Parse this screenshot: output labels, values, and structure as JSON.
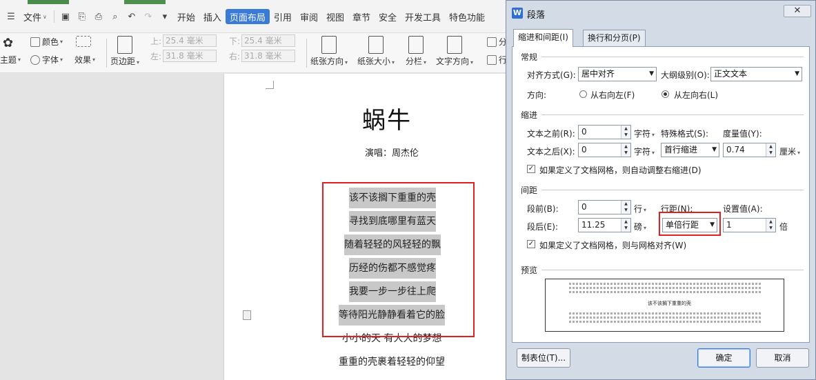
{
  "menubar": {
    "file_label": "文件",
    "tabs": [
      "开始",
      "插入",
      "页面布局",
      "引用",
      "审阅",
      "视图",
      "章节",
      "安全",
      "开发工具",
      "特色功能"
    ],
    "active_tab": "页面布局"
  },
  "ribbon": {
    "theme": "主题",
    "colors": "颜色",
    "fonts": "字体",
    "effects": "效果",
    "margins": "页边距",
    "top_label": "上:",
    "top_value": "25.4 毫米",
    "bottom_label": "下:",
    "bottom_value": "25.4 毫米",
    "left_label": "左:",
    "left_value": "31.8 毫米",
    "right_label": "右:",
    "right_value": "31.8 毫米",
    "orientation": "纸张方向",
    "size": "纸张大小",
    "columns": "分栏",
    "text_direction": "文字方向",
    "partial_1": "分",
    "partial_2": "行"
  },
  "document": {
    "title": "蜗牛",
    "subtitle": "演唱：周杰伦",
    "lines": [
      "该不该搁下重重的壳",
      "寻找到底哪里有蓝天",
      "随着轻轻的风轻轻的飘",
      "历经的伤都不感觉疼",
      "我要一步一步往上爬",
      "等待阳光静静看着它的脸",
      "小小的天 有大大的梦想",
      "重重的壳裹着轻轻的仰望"
    ]
  },
  "dialog": {
    "title": "段落",
    "tab_indent": "缩进和间距(I)",
    "tab_linebreak": "换行和分页(P)",
    "general": {
      "section": "常规",
      "align_label": "对齐方式(G):",
      "align_value": "居中对齐",
      "outline_label": "大纲级别(O):",
      "outline_value": "正文文本",
      "direction_label": "方向:",
      "rtl_label": "从右向左(F)",
      "ltr_label": "从左向右(L)"
    },
    "indent": {
      "section": "缩进",
      "before_label": "文本之前(R):",
      "before_value": "0",
      "before_unit": "字符",
      "after_label": "文本之后(X):",
      "after_value": "0",
      "after_unit": "字符",
      "special_label": "特殊格式(S):",
      "special_value": "首行缩进",
      "measure_label": "度量值(Y):",
      "measure_value": "0.74",
      "measure_unit": "厘米",
      "grid_check_label": "如果定义了文档网格，则自动调整右缩进(D)"
    },
    "spacing": {
      "section": "间距",
      "before_label": "段前(B):",
      "before_value": "0",
      "before_unit": "行",
      "after_label": "段后(E):",
      "after_value": "11.25",
      "after_unit": "磅",
      "line_label": "行距(N):",
      "line_value": "单倍行距",
      "set_label": "设置值(A):",
      "set_value": "1",
      "set_unit": "倍",
      "grid_check_label": "如果定义了文档网格，则与网格对齐(W)"
    },
    "preview": {
      "section": "预览",
      "sample": "该不该搁下重重的壳"
    },
    "buttons": {
      "tabs": "制表位(T)...",
      "ok": "确定",
      "cancel": "取消"
    }
  }
}
